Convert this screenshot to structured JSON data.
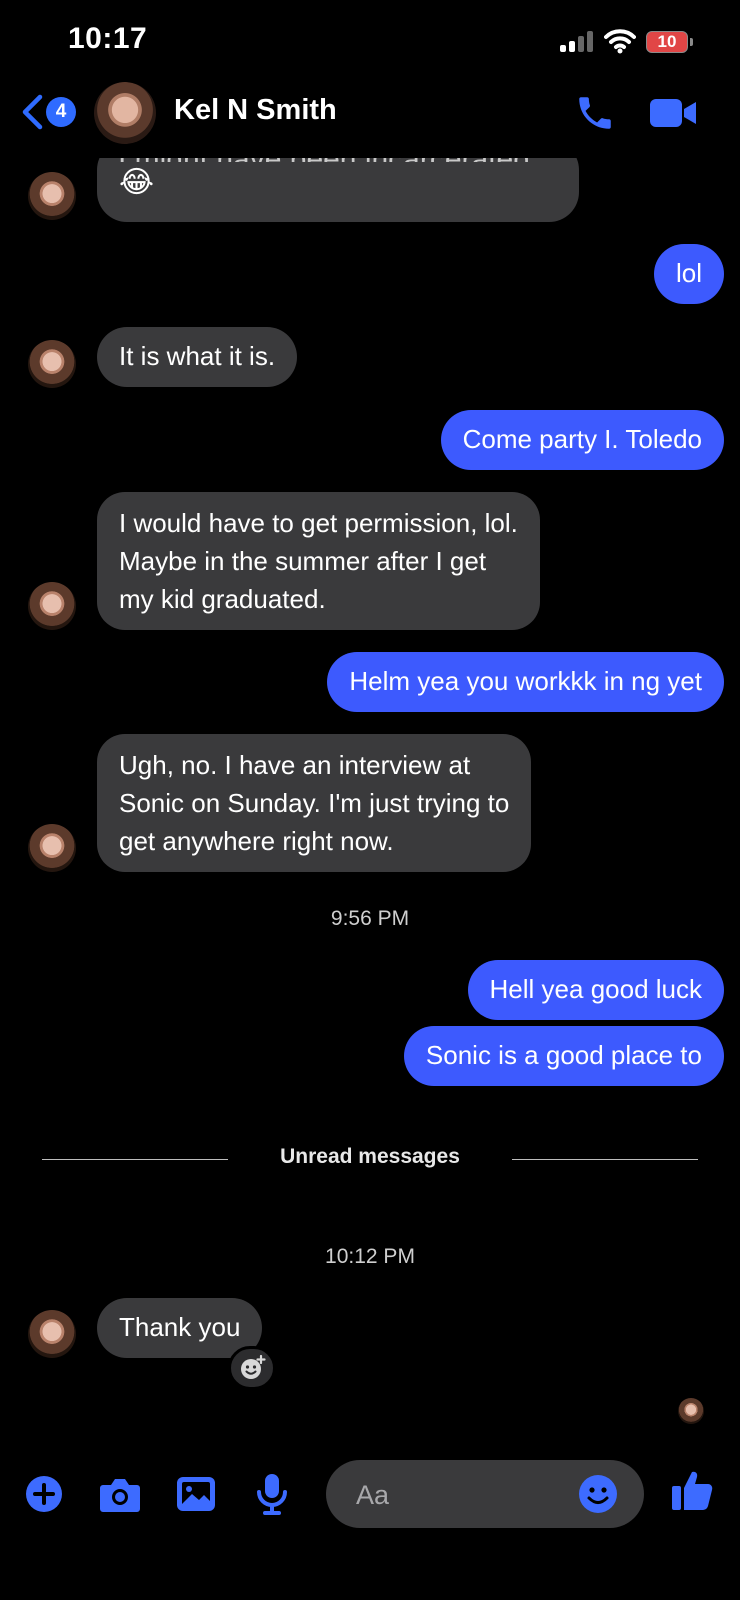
{
  "status_bar": {
    "time": "10:17",
    "battery": "10"
  },
  "header": {
    "back_badge": "4",
    "contact_name": "Kel N Smith"
  },
  "messages": [
    {
      "direction": "in",
      "text": "I might have been incarcerated.",
      "emoji": "😂"
    },
    {
      "direction": "out",
      "text": "lol"
    },
    {
      "direction": "in",
      "text": "It is what it is."
    },
    {
      "direction": "out",
      "text": "Come party I. Toledo"
    },
    {
      "direction": "in",
      "lines": [
        "I would have to get permission, lol.",
        "Maybe in the summer after I get",
        "my kid graduated."
      ]
    },
    {
      "direction": "out",
      "text": "Helm yea  you workkk in ng yet"
    },
    {
      "direction": "in",
      "lines": [
        "Ugh, no. I have an interview at",
        "Sonic on Sunday. I'm just trying to",
        "get anywhere right now."
      ]
    },
    {
      "direction": "out",
      "text": "Hell yea  good luck"
    },
    {
      "direction": "out",
      "text": "Sonic is a good place to"
    },
    {
      "direction": "in",
      "text": "Thank you"
    }
  ],
  "timestamps": {
    "first": "9:56 PM",
    "second": "10:12 PM"
  },
  "unread_label": "Unread messages",
  "composer": {
    "placeholder": "Aa"
  },
  "colors": {
    "accent": "#3d5afe",
    "incoming_bubble": "#3a3a3c",
    "badge": "#2f6bff"
  }
}
